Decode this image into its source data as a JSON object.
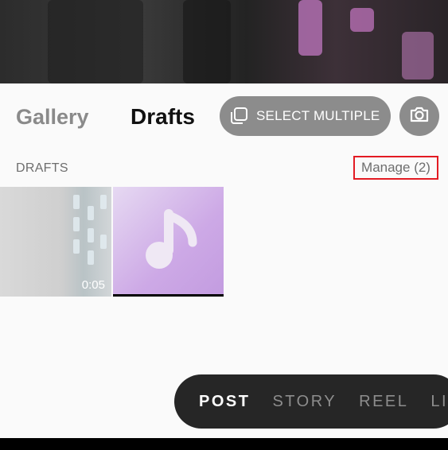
{
  "header": {
    "tabs": [
      {
        "label": "Gallery",
        "active": false
      },
      {
        "label": "Drafts",
        "active": true
      }
    ],
    "select_multiple_label": "SELECT MULTIPLE",
    "select_multiple_icon": "stack-squares-icon",
    "camera_icon": "camera-icon"
  },
  "drafts": {
    "section_label": "DRAFTS",
    "manage_label": "Manage (2)",
    "items": [
      {
        "kind": "video",
        "duration": "0:05"
      },
      {
        "kind": "audio",
        "icon": "music-note-icon"
      }
    ]
  },
  "mode_bar": {
    "modes": [
      "POST",
      "STORY",
      "REEL",
      "LI"
    ],
    "active": "POST"
  },
  "colors": {
    "accent_highlight": "#e31b23",
    "pill_bg": "#8c8c8c",
    "mode_bar_bg": "#262626"
  }
}
